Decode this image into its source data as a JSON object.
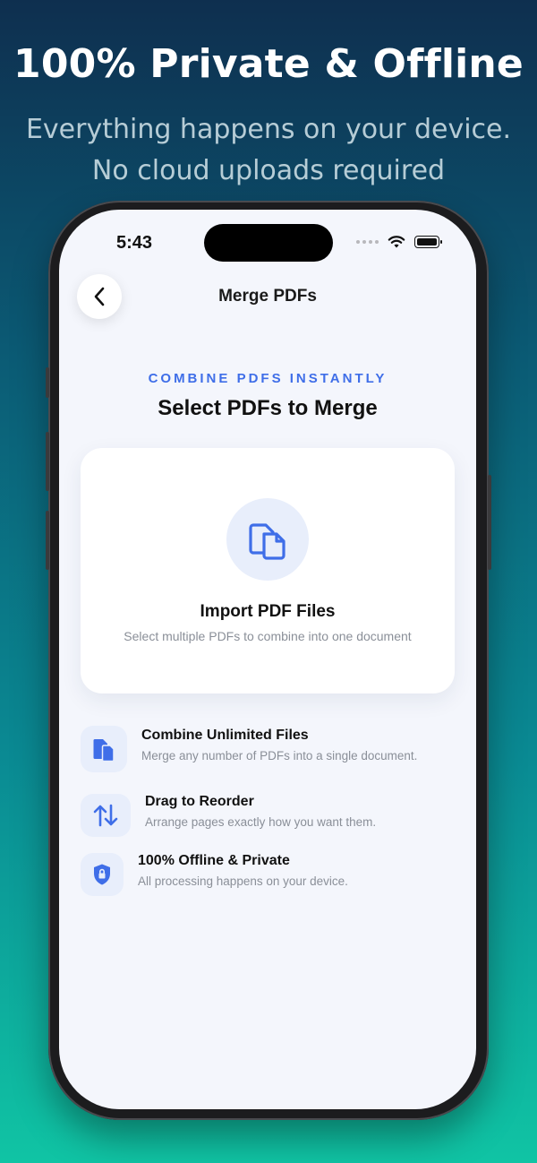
{
  "promo": {
    "headline": "100% Private & Offline",
    "subline_1": "Everything happens on your device.",
    "subline_2": "No cloud uploads required"
  },
  "status_bar": {
    "time": "5:43"
  },
  "nav": {
    "title": "Merge PDFs"
  },
  "intro": {
    "eyebrow": "COMBINE PDFS INSTANTLY",
    "heading": "Select PDFs to Merge"
  },
  "import_card": {
    "title": "Import PDF Files",
    "subtitle": "Select multiple PDFs to combine into one document"
  },
  "features": [
    {
      "icon": "documents-icon",
      "title": "Combine Unlimited Files",
      "description": "Merge any number of PDFs into a single document."
    },
    {
      "icon": "reorder-arrows-icon",
      "title": "Drag to Reorder",
      "description": "Arrange pages exactly how you want them."
    },
    {
      "icon": "shield-lock-icon",
      "title": "100% Offline & Private",
      "description": "All processing happens on your device."
    }
  ],
  "colors": {
    "accent": "#3f6ee8",
    "icon_bg": "#e8eefb",
    "screen_bg": "#f4f6fc",
    "gradient_top": "#0e2f4f",
    "gradient_bottom": "#10c4a4"
  }
}
